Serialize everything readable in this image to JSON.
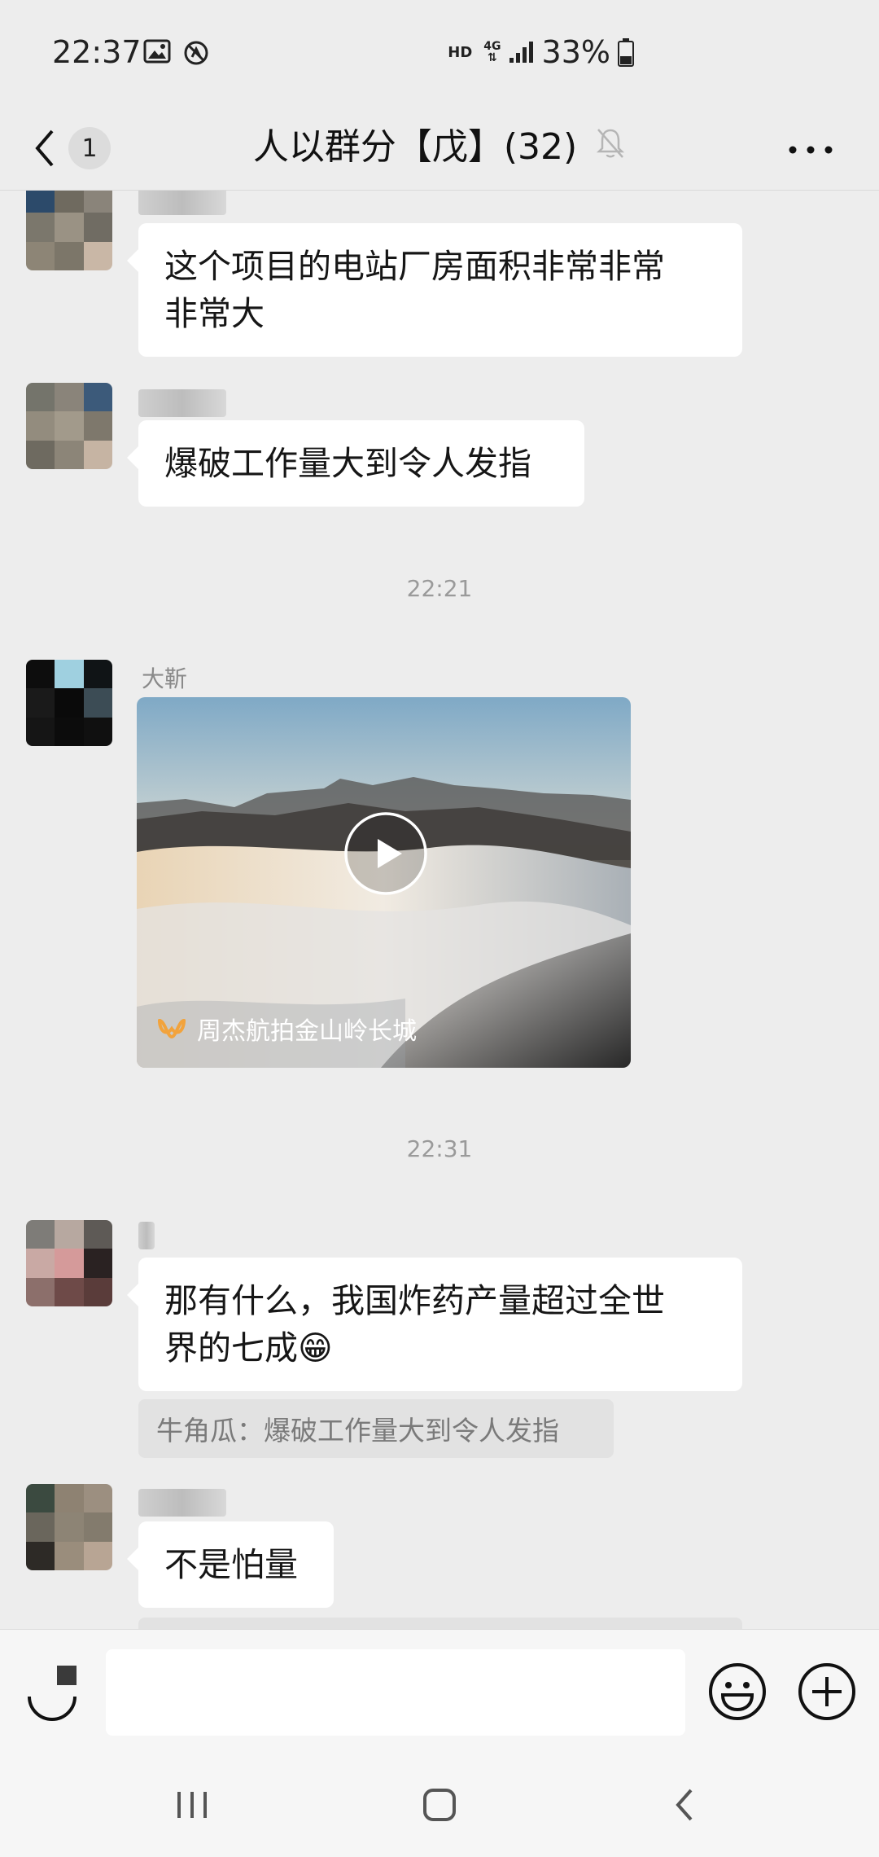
{
  "status_bar": {
    "time": "22:37",
    "hd": "HD",
    "network": "4G",
    "battery": "33%"
  },
  "nav": {
    "unread_count": "1",
    "title": "人以群分【戊】(32)"
  },
  "messages": [
    {
      "text_line1": "这个项目的电站厂房面积非常非常",
      "text_line2": "非常大"
    },
    {
      "text": "爆破工作量大到令人发指"
    },
    {
      "sender": "大靳",
      "video_caption": "周杰航拍金山岭长城"
    },
    {
      "text_line1": "那有什么，我国炸药产量超过全世",
      "text_line2": "界的七成",
      "emoji": "😁",
      "quote": "牛角瓜：爆破工作量大到令人发指"
    },
    {
      "text": "不是怕量"
    }
  ],
  "time_separators": [
    "22:21",
    "22:31"
  ],
  "input": {
    "placeholder": ""
  },
  "colors": {
    "background": "#ededed",
    "bubble": "#ffffff",
    "quote_bg": "#e2e2e2"
  }
}
